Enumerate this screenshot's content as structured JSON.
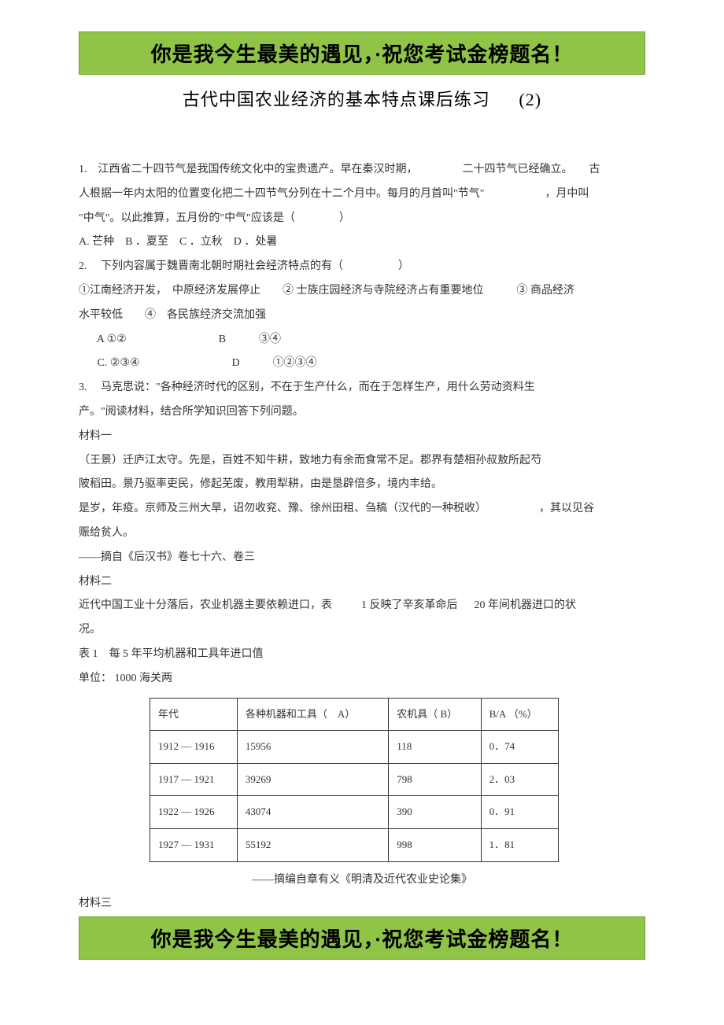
{
  "banner": "你是我今生最美的遇见，·祝您考试金榜题名！",
  "title_main": "古代中国农业经济的基本特点课后练习",
  "title_num": "(2)",
  "q1": {
    "prefix": "1.　江西省二十四节气是我国传统文化中的宝贵遗产。早在秦汉时期，",
    "mid1": "二十四节气已经确立。",
    "mid2": "古",
    "line2a": "人根据一年内太阳的位置变化把二十四节气分列在十二个月中。每月的月首叫\"节气\"",
    "line2b": "，月中叫",
    "line3": "\"中气\"。以此推算，五月份的\"中气\"应该是（　　　　）",
    "opts": "A. 芒种　B ．夏至　C ．立秋　D ．处暑"
  },
  "q2": {
    "line1": "2.　 下列内容属于魏晋南北朝时期社会经济特点的有（　　　　　）",
    "line2a": "①江南经济开发，　中原经济发展停止　　② 士族庄园经济与寺院经济占有重要地位　　　③ 商品经济",
    "line2b": "水平较低　　④　各民族经济交流加强",
    "optA": "A ①②",
    "optB": "B　　　③④",
    "optC": "C. ②③④",
    "optD": "D　　　①②③④"
  },
  "q3": {
    "line1": "3.　 马克思说：\"各种经济时代的区别，不在于生产什么，而在于怎样生产，用什么劳动资料生",
    "line2": "产。\"阅读材料，结合所学知识回答下列问题。",
    "m1_label": "材料一",
    "m1_l1": "（王景）迁庐江太守。先是，百姓不知牛耕，致地力有余而食常不足。郡界有楚相孙叔敖所起芍",
    "m1_l2": "陂稻田。景乃驱率吏民，修起芜废，教用犁耕，由是垦辟倍多，境内丰给。",
    "m1_l3a": "是岁，年疫。京师及三州大旱，诏勿收兖、豫、徐州田租、刍稿（汉代的一种税收）",
    "m1_l3b": "，其以见谷",
    "m1_l4": "赈给贫人。",
    "m1_src": "——摘自《后汉书》卷七十六、卷三",
    "m2_label": "材料二",
    "m2_l1a": "近代中国工业十分落后，农业机器主要依赖进口，表",
    "m2_l1b": "1 反映了辛亥革命后",
    "m2_l1c": "20 年间机器进口的状",
    "m2_l2": "况。",
    "table_title": "表 1　每 5 年平均机器和工具年进口值",
    "unit": "单位： 1000 海关两",
    "m2_src": "——摘编自章有义《明清及近代农业史论集》",
    "m3_label": "材料三"
  },
  "chart_data": {
    "type": "table",
    "headers": [
      "年代",
      "各种机器和工具（　A）",
      "农机具（ B）",
      "B/A （%）"
    ],
    "rows": [
      [
        "1912 — 1916",
        "15956",
        "118",
        "0．74"
      ],
      [
        "1917 — 1921",
        "39269",
        "798",
        "2．03"
      ],
      [
        "1922 — 1926",
        "43074",
        "390",
        "0．91"
      ],
      [
        "1927 — 1931",
        "55192",
        "998",
        "1．81"
      ]
    ]
  }
}
